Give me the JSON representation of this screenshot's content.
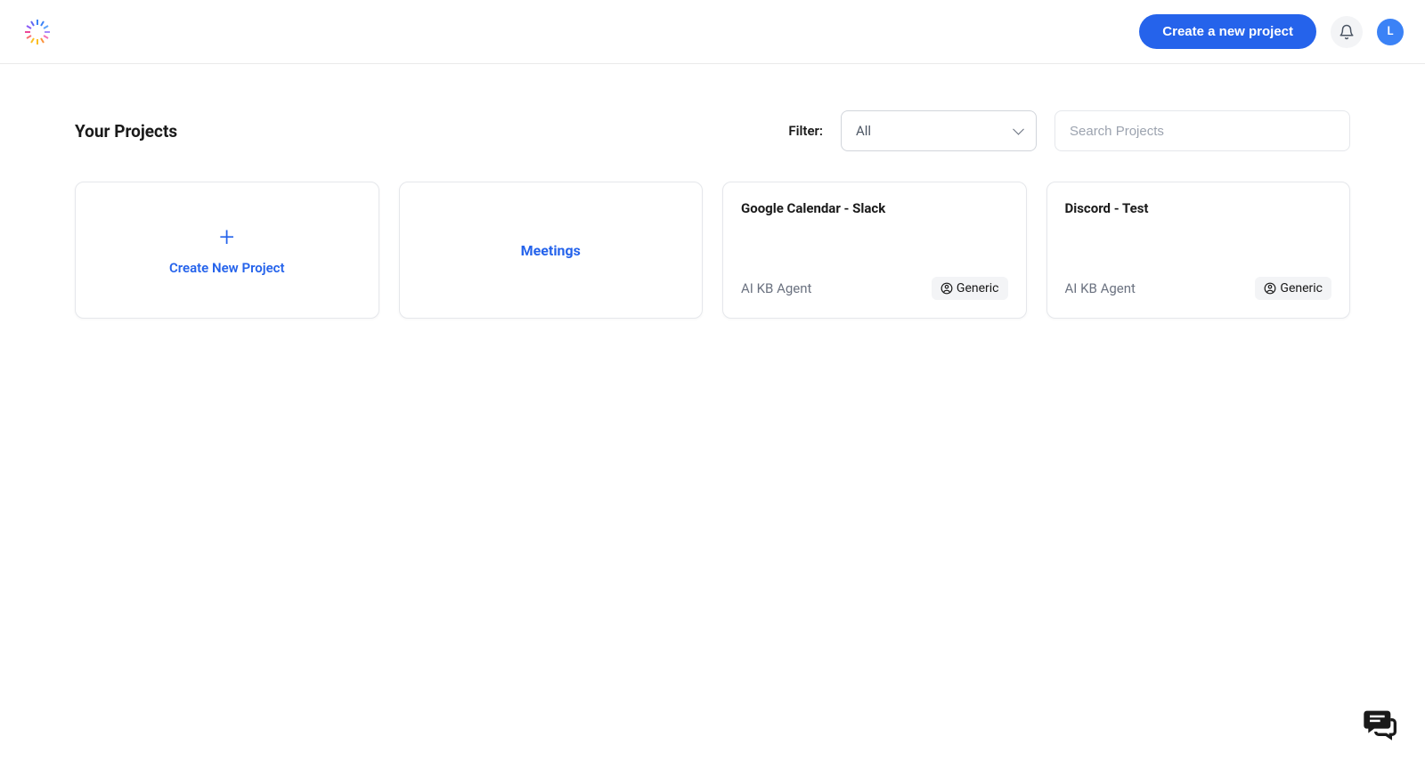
{
  "header": {
    "create_project_label": "Create a new project",
    "avatar_initial": "L"
  },
  "toolbar": {
    "title": "Your Projects",
    "filter_label": "Filter:",
    "filter_value": "All",
    "search_placeholder": "Search Projects"
  },
  "cards": {
    "create_new_label": "Create New Project",
    "projects": [
      {
        "title": "Meetings",
        "type": "simple"
      },
      {
        "title": "Google Calendar - Slack",
        "agent": "AI KB Agent",
        "badge": "Generic",
        "type": "full"
      },
      {
        "title": "Discord - Test",
        "agent": "AI KB Agent",
        "badge": "Generic",
        "type": "full"
      }
    ]
  }
}
